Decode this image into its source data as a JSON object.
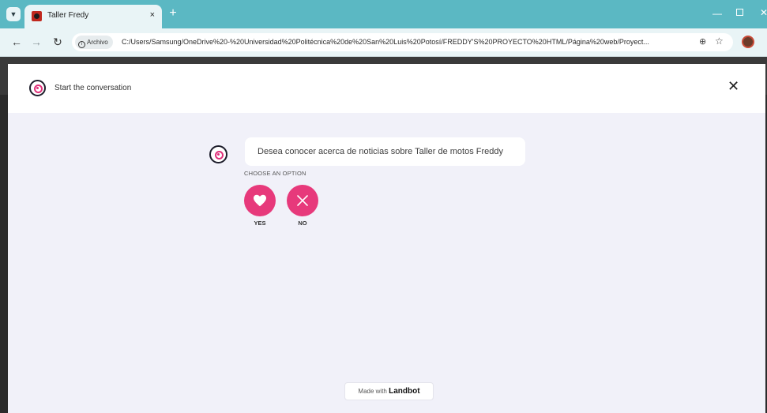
{
  "browser": {
    "tab_title": "Taller Fredy",
    "tab_close": "×",
    "new_tab": "+",
    "chip_label": "Archivo",
    "url": "C:/Users/Samsung/OneDrive%20-%20Universidad%20Politécnica%20de%20San%20Luis%20Potosí/FREDDY'S%20PROYECTO%20HTML/Página%20web/Proyect...",
    "icons": [
      "tab-menu-icon",
      "back-icon",
      "forward-icon",
      "reload-icon",
      "info-icon",
      "zoom-icon",
      "star-icon",
      "profile-avatar",
      "minimize-icon",
      "maximize-icon",
      "close-icon"
    ]
  },
  "widget": {
    "header_title": "Start the conversation",
    "close_glyph": "✕",
    "message": "Desea conocer acerca de noticias sobre Taller de motos Freddy",
    "options_caption": "CHOOSE AN OPTION",
    "options": [
      {
        "label": "YES",
        "icon": "heart-icon"
      },
      {
        "label": "NO",
        "icon": "x-icon"
      }
    ],
    "footer_prefix": "Made with",
    "footer_brand": "Landbot"
  },
  "colors": {
    "tabstrip": "#5bb8c3",
    "accent": "#e7397b",
    "widget_bg": "#f1f1f9"
  }
}
